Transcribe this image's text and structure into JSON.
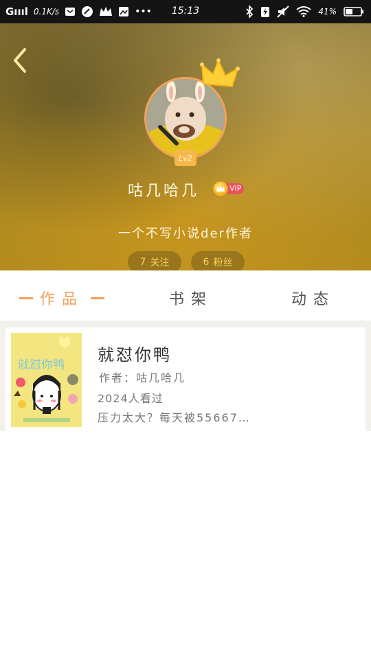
{
  "status_bar": {
    "signal": "Gıııl",
    "speed": "0.1K/s",
    "dots": "•••",
    "time": "15:13",
    "battery": "41%"
  },
  "profile": {
    "level": "Lv2",
    "username": "咕几哈几",
    "vip": "VIP",
    "bio": "一个不写小说der作者",
    "follow_count": "7",
    "follow_label": "关注",
    "fans_count": "6",
    "fans_label": "粉丝"
  },
  "tabs": {
    "works": "作品",
    "shelf": "书架",
    "activity": "动态"
  },
  "book": {
    "title": "就怼你鸭",
    "author": "作者：咕几哈几",
    "views": "2024人看过",
    "desc": "压力太大？每天被55667…",
    "cover_title": "就怼你鸭"
  },
  "colors": {
    "accent": "#f0a05c",
    "pill_text": "#f9d25a",
    "vip_red": "#e8525c"
  }
}
